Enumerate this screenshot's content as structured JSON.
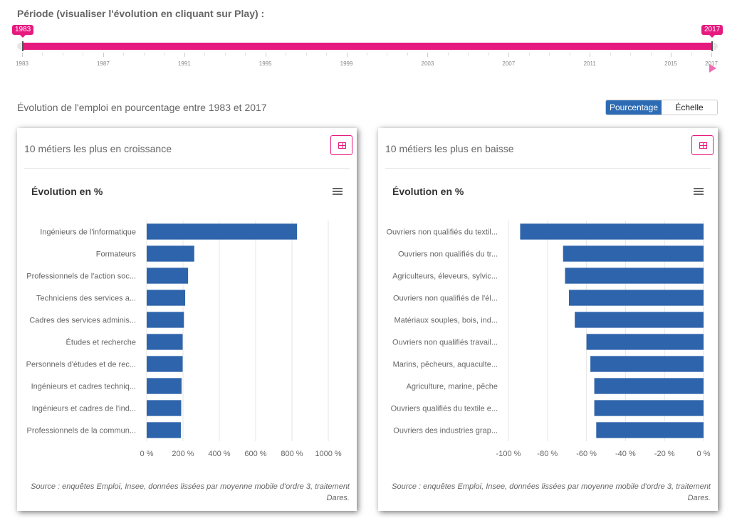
{
  "period": {
    "label": "Période (visualiser l'évolution en cliquant sur Play) :",
    "start": "1983",
    "end": "2017",
    "tick_labels": [
      "1983",
      "1987",
      "1991",
      "1995",
      "1999",
      "2003",
      "2007",
      "2011",
      "2015",
      "2017"
    ],
    "accent_color": "#e6197f"
  },
  "subtitle": "Évolution de l'emploi en pourcentage entre 1983 et 2017",
  "toggle": {
    "option1": "Pourcentage",
    "option2": "Échelle",
    "selected": "Pourcentage"
  },
  "left_panel": {
    "title": "10 métiers les plus en croissance",
    "chart_title": "Évolution en %",
    "source": "Source : enquêtes Emploi, Insee, données lissées par moyenne mobile d'ordre 3, traitement Dares."
  },
  "right_panel": {
    "title": "10 métiers les plus en baisse",
    "chart_title": "Évolution en %",
    "source": "Source : enquêtes Emploi, Insee, données lissées par moyenne mobile d'ordre 3, traitement Dares."
  },
  "chart_data": [
    {
      "type": "bar",
      "orientation": "horizontal",
      "title": "Évolution en %",
      "categories": [
        "Ingénieurs de l'informatique",
        "Formateurs",
        "Professionnels de l'action soc...",
        "Techniciens des services a...",
        "Cadres des services adminis...",
        "Études et recherche",
        "Personnels d'études et de rec...",
        "Ingénieurs et cadres techniq...",
        "Ingénieurs et cadres de l'ind...",
        "Professionnels de la commun..."
      ],
      "values": [
        828,
        262,
        228,
        212,
        205,
        198,
        198,
        192,
        190,
        188
      ],
      "xlim": [
        0,
        1000
      ],
      "x_ticks": [
        0,
        200,
        400,
        600,
        800,
        1000
      ],
      "x_tick_labels": [
        "0 %",
        "200 %",
        "400 %",
        "600 %",
        "800 %",
        "1000 %"
      ],
      "bar_color": "#2d64ab",
      "grid": true
    },
    {
      "type": "bar",
      "orientation": "horizontal",
      "title": "Évolution en %",
      "categories": [
        "Ouvriers non qualifiés du textil...",
        "Ouvriers non qualifiés du tr...",
        "Agriculteurs, éleveurs, sylvic...",
        "Ouvriers non qualifiés de l'él...",
        "Matériaux souples, bois, ind...",
        "Ouvriers non qualifiés travail...",
        "Marins, pêcheurs, aquaculte...",
        "Agriculture, marine, pêche",
        "Ouvriers qualifiés du textile e...",
        "Ouvriers des industries grap..."
      ],
      "values": [
        -94,
        -72,
        -71,
        -69,
        -66,
        -60,
        -58,
        -56,
        -56,
        -55
      ],
      "xlim": [
        -100,
        0
      ],
      "x_ticks": [
        -100,
        -80,
        -60,
        -40,
        -20,
        0
      ],
      "x_tick_labels": [
        "-100 %",
        "-80 %",
        "-60 %",
        "-40 %",
        "-20 %",
        "0 %"
      ],
      "bar_color": "#2d64ab",
      "grid": true
    }
  ]
}
